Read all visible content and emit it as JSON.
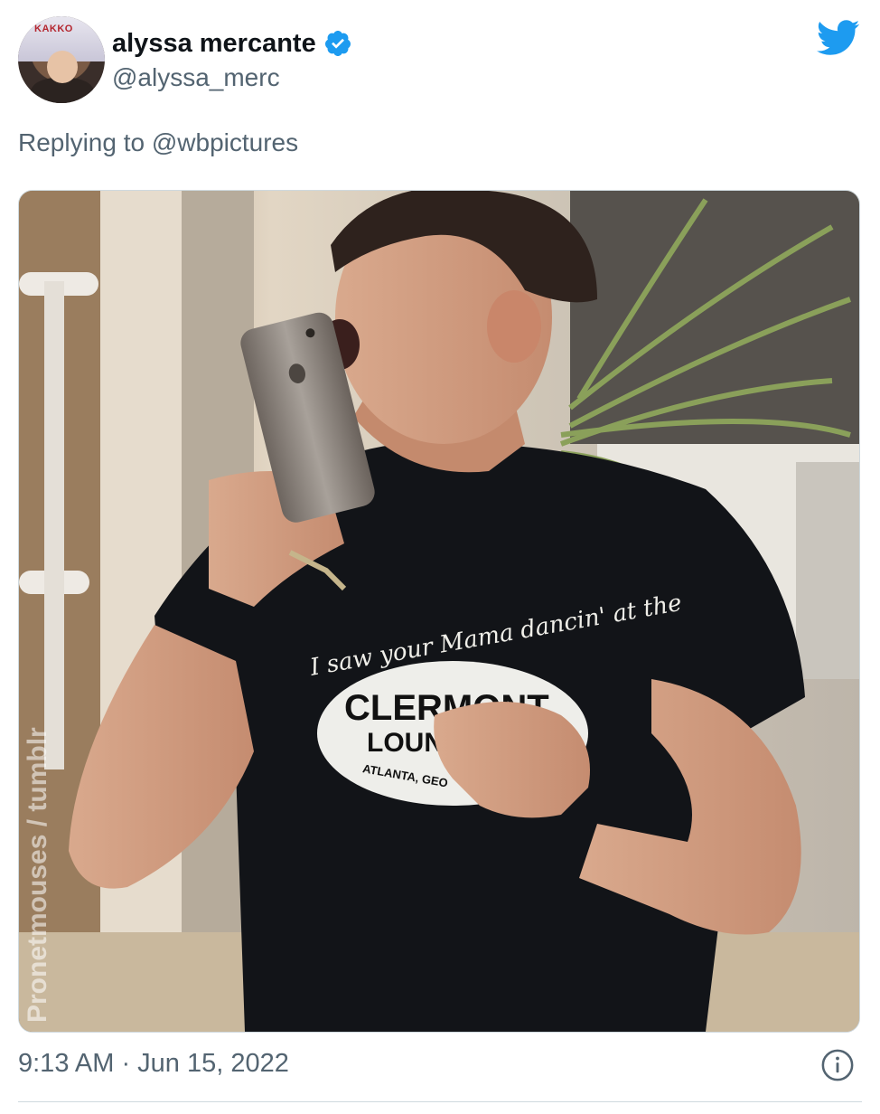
{
  "tweet": {
    "author": {
      "display_name": "alyssa mercante",
      "handle": "@alyssa_merc",
      "verified": true,
      "avatar_jersey_text": "KAKKO"
    },
    "reply_prefix": "Replying to ",
    "reply_to": "@wbpictures",
    "timestamp": "9:13 AM · Jun 15, 2022",
    "media": {
      "shirt_script": "I saw your Mama dancin' at the",
      "shirt_title": "CLERMONT",
      "shirt_sub": "LOUN",
      "shirt_city": "ATLANTA, GEO",
      "watermark": "Pronetmouses / tumblr"
    }
  },
  "colors": {
    "text_primary": "#0f1419",
    "text_secondary": "#536471",
    "twitter_blue": "#1d9bf0",
    "border": "#cfd9de"
  },
  "icons": [
    "verified-badge-icon",
    "twitter-bird-icon",
    "info-icon"
  ]
}
